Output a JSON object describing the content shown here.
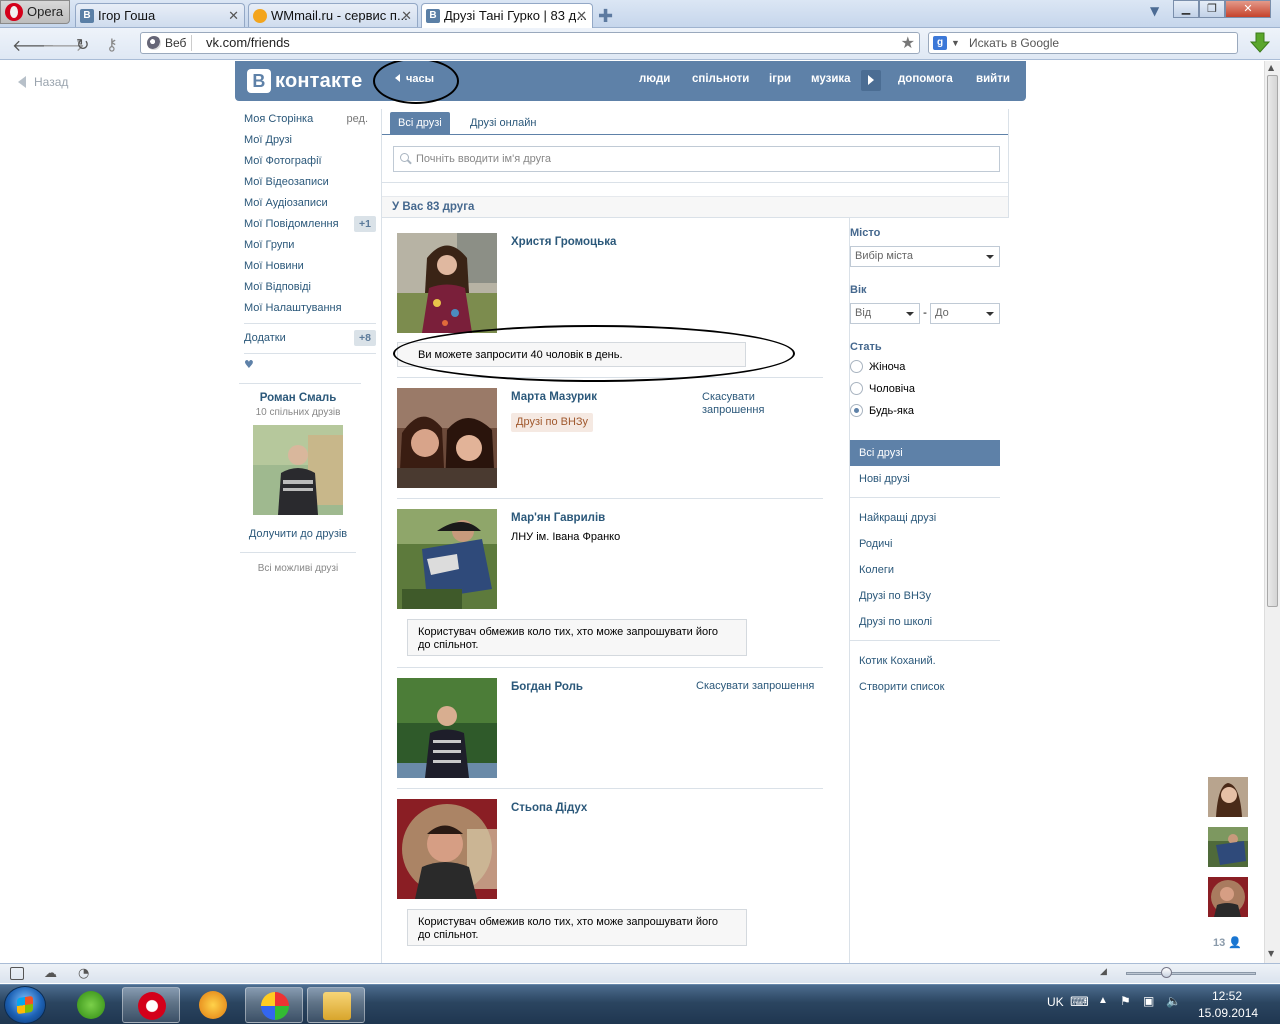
{
  "browser": {
    "menu_label": "Opera",
    "tabs": [
      {
        "title": "Ігор Гоша",
        "favicon": "В"
      },
      {
        "title": "WMmail.ru - сервис п...",
        "favicon": ""
      },
      {
        "title": "Друзі Тані Гурко | 83 д...",
        "favicon": "В"
      }
    ],
    "web_badge": "Веб",
    "url": "vk.com/friends",
    "search_placeholder": "Искать в Google",
    "search_engine_badge": "g"
  },
  "page": {
    "back_label": "Назад",
    "header": {
      "logo_letter": "В",
      "logo_text": "контакте",
      "time_label": "часы",
      "nav": [
        "люди",
        "спільноти",
        "ігри",
        "музика",
        "допомога",
        "вийти"
      ]
    },
    "left_menu": {
      "items": [
        {
          "label": "Моя Сторінка",
          "extra": "ред."
        },
        {
          "label": "Мої Друзі"
        },
        {
          "label": "Мої Фотографії"
        },
        {
          "label": "Мої Відеозаписи"
        },
        {
          "label": "Мої Аудіозаписи"
        },
        {
          "label": "Мої Повідомлення",
          "badge": "+1"
        },
        {
          "label": "Мої Групи"
        },
        {
          "label": "Мої Новини"
        },
        {
          "label": "Мої Відповіді"
        },
        {
          "label": "Мої Налаштування"
        }
      ],
      "apps": {
        "label": "Додатки",
        "badge": "+8"
      },
      "heart": "♥"
    },
    "suggestion": {
      "name": "Роман Смаль",
      "mutual": "10 спільних друзів",
      "add_label": "Долучити до друзів",
      "all_label": "Всі можливі друзі"
    },
    "tabs": [
      "Всі друзі",
      "Друзі онлайн"
    ],
    "friend_search_placeholder": "Почніть вводити ім'я друга",
    "count_label": "У Вас 83 друга",
    "invite_notice": "Ви можете запросити 40 чоловік в день.",
    "restricted_notice_line1": "Користувач обмежив коло тих, хто може запрошувати його",
    "restricted_notice_line2": "до спільнот.",
    "friends": [
      {
        "name": "Христя Громоцька"
      },
      {
        "name": "Марта Мазурик",
        "tag": "Друзі по ВНЗу",
        "action_line1": "Скасувати",
        "action_line2": "запрошення"
      },
      {
        "name": "Мар'ян Гаврилів",
        "sub": "ЛНУ ім. Івана Франко"
      },
      {
        "name": "Богдан Роль",
        "action": "Скасувати запрошення"
      },
      {
        "name": "Стьопа Дідух"
      }
    ],
    "filters": {
      "city_label": "Місто",
      "city_select": "Вибір міста",
      "age_label": "Вік",
      "age_from": "Від",
      "age_dash": "-",
      "age_to": "До",
      "sex_label": "Стать",
      "sex_options": [
        {
          "label": "Жіноча",
          "checked": false
        },
        {
          "label": "Чоловіча",
          "checked": false
        },
        {
          "label": "Будь-яка",
          "checked": true
        }
      ],
      "lists_a": [
        "Всі друзі",
        "Нові друзі"
      ],
      "lists_b": [
        "Найкращі друзі",
        "Родичі",
        "Колеги",
        "Друзі по ВНЗу",
        "Друзі по школі"
      ],
      "lists_c": [
        "Котик Коханий.",
        "Створити список"
      ]
    },
    "dock_count": "13"
  },
  "taskbar": {
    "lang": "UK",
    "time": "12:52",
    "date": "15.09.2014"
  },
  "colors": {
    "vk_blue": "#5e81a8",
    "vk_link": "#2b587a",
    "tag_bg": "#f5e9e2"
  }
}
